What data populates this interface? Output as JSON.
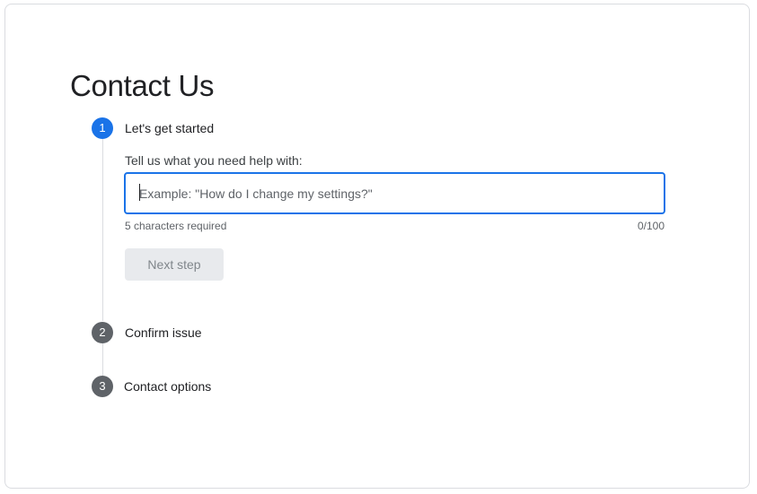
{
  "page": {
    "title": "Contact Us"
  },
  "steps": [
    {
      "number": "1",
      "label": "Let's get started",
      "state": "active"
    },
    {
      "number": "2",
      "label": "Confirm issue",
      "state": "inactive"
    },
    {
      "number": "3",
      "label": "Contact options",
      "state": "inactive"
    }
  ],
  "form": {
    "prompt": "Tell us what you need help with:",
    "input_value": "",
    "input_placeholder": "Example: \"How do I change my settings?\"",
    "hint": "5 characters required",
    "counter": "0/100",
    "next_button_label": "Next step",
    "next_button_disabled": true
  },
  "colors": {
    "accent": "#1a73e8",
    "inactive_step": "#5f6368",
    "disabled_button_bg": "#e8eaed",
    "disabled_button_text": "#80868b",
    "border": "#dadce0"
  }
}
